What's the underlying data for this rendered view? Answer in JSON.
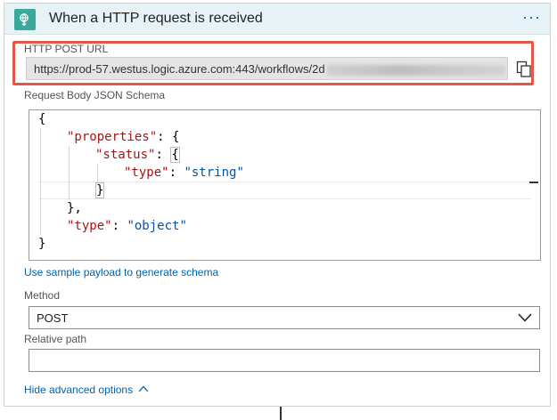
{
  "trigger": {
    "title": "When a HTTP request is received",
    "icon": "http-request-icon",
    "more_icon": "ellipsis-icon",
    "more_label": "···"
  },
  "post_url": {
    "label": "HTTP POST URL",
    "value": "https://prod-57.westus.logic.azure.com:443/workflows/2d",
    "copy_icon": "copy-icon"
  },
  "schema": {
    "label": "Request Body JSON Schema",
    "lines": [
      "{",
      "\"properties\": {",
      "\"status\": {",
      "\"type\": \"string\"",
      "}",
      "},",
      "\"type\": \"object\"",
      "}"
    ],
    "tokens": {
      "open_brace": "{",
      "properties_key": "\"properties\"",
      "status_key": "\"status\"",
      "type_key": "\"type\"",
      "string_value": "\"string\"",
      "object_value": "\"object\"",
      "close_brace": "}",
      "close_brace_comma": "},",
      "colon": ":",
      "colon_space_brace": ": {"
    }
  },
  "sample_payload_link": "Use sample payload to generate schema",
  "method": {
    "label": "Method",
    "value": "POST",
    "icon": "chevron-down-icon"
  },
  "relative_path": {
    "label": "Relative path",
    "value": ""
  },
  "advanced_link": {
    "label": "Hide advanced options",
    "icon": "chevron-up-icon"
  },
  "colors": {
    "header_bg": "#e6f2f5",
    "trigger_icon_bg": "#3aa89b",
    "highlight_border": "#e2574c",
    "link": "#0062ad",
    "json_key": "#a31515",
    "json_string": "#0451a5"
  }
}
